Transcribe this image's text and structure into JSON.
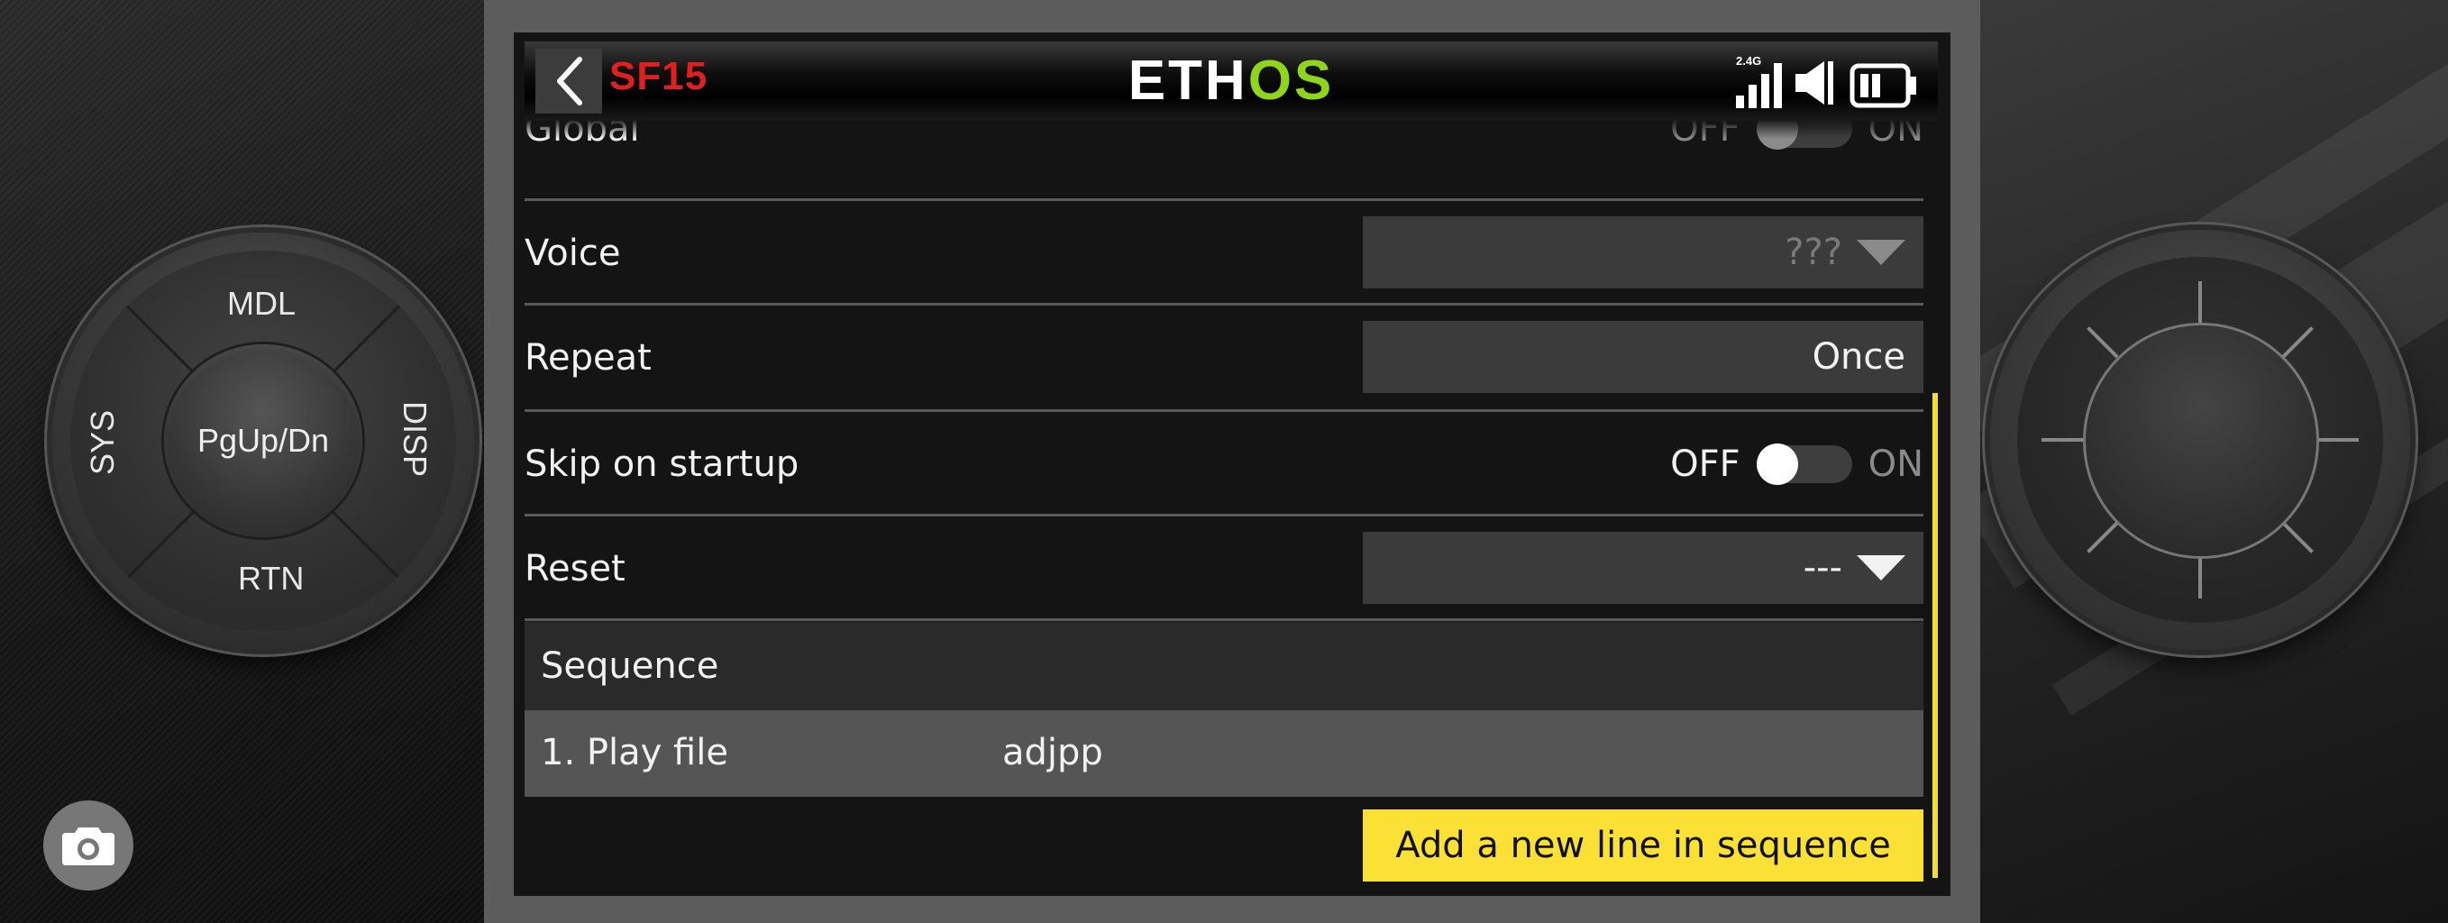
{
  "header": {
    "model_name": "SF15",
    "brand_part1": "ETH",
    "brand_part2": "OS",
    "rf_band": "2.4G"
  },
  "rows": {
    "global": {
      "label": "Global",
      "off_label": "OFF",
      "on_label": "ON",
      "state": "off"
    },
    "voice": {
      "label": "Voice",
      "value": "???"
    },
    "repeat": {
      "label": "Repeat",
      "value": "Once"
    },
    "skip_on_startup": {
      "label": "Skip on startup",
      "off_label": "OFF",
      "on_label": "ON",
      "state": "off"
    },
    "reset": {
      "label": "Reset",
      "value": "---"
    }
  },
  "sequence": {
    "header": "Sequence",
    "items": [
      {
        "label": "1. Play file",
        "value": "adjpp"
      }
    ],
    "add_button": "Add a new line in sequence"
  },
  "dpad": {
    "top": "MDL",
    "left": "SYS",
    "right": "DISP",
    "bottom": "RTN",
    "center": "PgUp/Dn"
  },
  "icons": {
    "back": "chevron-left-icon",
    "signal": "signal-bars-icon",
    "volume": "speaker-icon",
    "battery": "battery-icon",
    "camera": "camera-icon"
  },
  "colors": {
    "model_name": "#e02020",
    "brand_accent": "#8fd61a",
    "add_button": "#fbe036",
    "scrollbar": "#f2de3a",
    "screen_bg": "#141414"
  }
}
